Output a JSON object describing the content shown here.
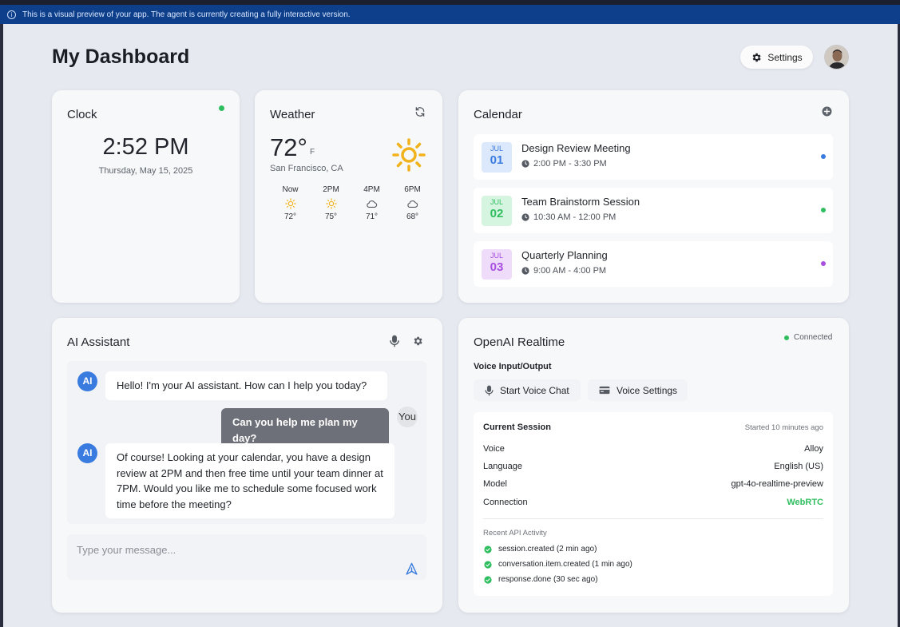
{
  "banner": {
    "text": "This is a visual preview of your app. The agent is currently creating a fully interactive version."
  },
  "header": {
    "title": "My Dashboard",
    "settings_label": "Settings"
  },
  "clock": {
    "title": "Clock",
    "time": "2:52 PM",
    "date": "Thursday, May 15, 2025",
    "status_color": "#2fbe5f"
  },
  "weather": {
    "title": "Weather",
    "temp": "72°",
    "unit": "F",
    "location": "San Francisco, CA",
    "forecast": [
      {
        "label": "Now",
        "icon": "sun-icon",
        "temp": "72°"
      },
      {
        "label": "2PM",
        "icon": "sun-icon",
        "temp": "75°"
      },
      {
        "label": "4PM",
        "icon": "cloud-icon",
        "temp": "71°"
      },
      {
        "label": "6PM",
        "icon": "cloud-icon",
        "temp": "68°"
      }
    ]
  },
  "calendar": {
    "title": "Calendar",
    "events": [
      {
        "month": "JUL",
        "day": "01",
        "title": "Design Review Meeting",
        "time": "2:00 PM - 3:30 PM",
        "color": "#3a7be0"
      },
      {
        "month": "JUL",
        "day": "02",
        "title": "Team Brainstorm Session",
        "time": "10:30 AM - 12:00 PM",
        "color": "#2fbe5f"
      },
      {
        "month": "JUL",
        "day": "03",
        "title": "Quarterly Planning",
        "time": "9:00 AM - 4:00 PM",
        "color": "#a84fe0"
      }
    ]
  },
  "assistant": {
    "title": "AI Assistant",
    "ai_label": "AI",
    "you_label": "You",
    "messages": [
      {
        "from": "ai",
        "text": "Hello! I'm your AI assistant. How can I help you today?"
      },
      {
        "from": "user",
        "text": "Can you help me plan my day?"
      },
      {
        "from": "ai",
        "text": "Of course! Looking at your calendar, you have a design review at 2PM and then free time until your team dinner at 7PM. Would you like me to schedule some focused work time before the meeting?"
      }
    ],
    "input_placeholder": "Type your message..."
  },
  "realtime": {
    "title": "OpenAI Realtime",
    "status": "Connected",
    "subtitle": "Voice Input/Output",
    "start_voice_label": "Start Voice Chat",
    "voice_settings_label": "Voice Settings",
    "session": {
      "title": "Current Session",
      "started": "Started 10 minutes ago",
      "rows": [
        {
          "label": "Voice",
          "value": "Alloy"
        },
        {
          "label": "Language",
          "value": "English (US)"
        },
        {
          "label": "Model",
          "value": "gpt-4o-realtime-preview"
        },
        {
          "label": "Connection",
          "value": "WebRTC"
        }
      ],
      "recent_title": "Recent API Activity",
      "activity": [
        "session.created (2 min ago)",
        "conversation.item.created (1 min ago)",
        "response.done (30 sec ago)"
      ]
    }
  }
}
